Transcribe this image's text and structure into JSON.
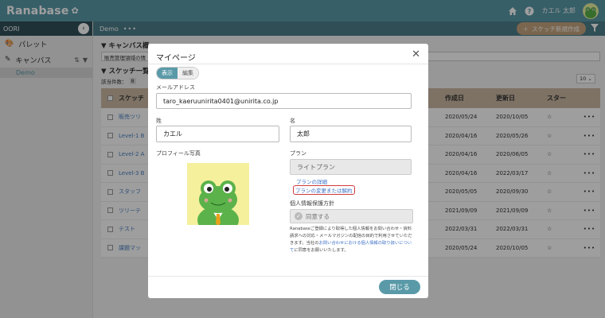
{
  "app": {
    "logo": "Ranabase",
    "user_name": "カエル 太郎"
  },
  "sidebar": {
    "workspace": "OORI",
    "items": [
      {
        "label": "パレット",
        "icon": "palette-icon"
      },
      {
        "label": "キャンバス",
        "icon": "brush-icon"
      }
    ],
    "sub_item": "Demo"
  },
  "main": {
    "breadcrumb": "Demo",
    "more": "•••",
    "new_sketch_label": "スケッチ新規作成",
    "canvas_section": "▼ キャンバス概",
    "canvas_desc": "販売管理領域の情",
    "sketch_section": "▼ スケッチ一覧",
    "count_label": "該当件数：",
    "count_value": "8",
    "per_page": "10",
    "columns": {
      "name": "スケッチ",
      "created": "作成日",
      "updated": "更新日",
      "star": "スター"
    },
    "rows": [
      {
        "name": "販売ツリ",
        "created": "2020/05/24",
        "updated": "2020/10/05"
      },
      {
        "name": "Level-1 B",
        "created": "2020/04/16",
        "updated": "2020/05/26"
      },
      {
        "name": "Level-2 A",
        "created": "2020/04/16",
        "updated": "2020/06/05"
      },
      {
        "name": "Level-3 B",
        "created": "2020/04/16",
        "updated": "2022/03/17"
      },
      {
        "name": "スタッフ",
        "created": "2020/05/05",
        "updated": "2020/09/30"
      },
      {
        "name": "ツリーテ",
        "created": "2021/09/09",
        "updated": "2021/09/09"
      },
      {
        "name": "テスト",
        "created": "2022/03/31",
        "updated": "2022/03/31"
      },
      {
        "name": "課題マッ",
        "created": "2020/05/24",
        "updated": "2020/10/05"
      }
    ]
  },
  "modal": {
    "title": "マイページ",
    "toggle_view": "表示",
    "toggle_edit": "編集",
    "email_label": "メールアドレス",
    "email_value": "taro_kaeruunirita0401@unirita.co.jp",
    "last_name_label": "姓",
    "last_name_value": "カエル",
    "first_name_label": "名",
    "first_name_value": "太郎",
    "photo_label": "プロフィール写真",
    "plan_label": "プラン",
    "plan_value": "ライトプラン",
    "plan_details_link": "プランの詳細",
    "plan_change_link": "プランの変更または解約",
    "privacy_label": "個人情報保護方針",
    "consent_label": "同意する",
    "privacy_text_1": "Ranabaseご登録により取得した個人情報をお問い合わせ・資料請求への対応・メールマガジンの配信の目的で利用させていただきます。当社の",
    "privacy_link": "お問い合わせにおける個人情報の取り扱いについて",
    "privacy_text_2": "に同意をお願いいたします。",
    "close_label": "閉じる"
  }
}
